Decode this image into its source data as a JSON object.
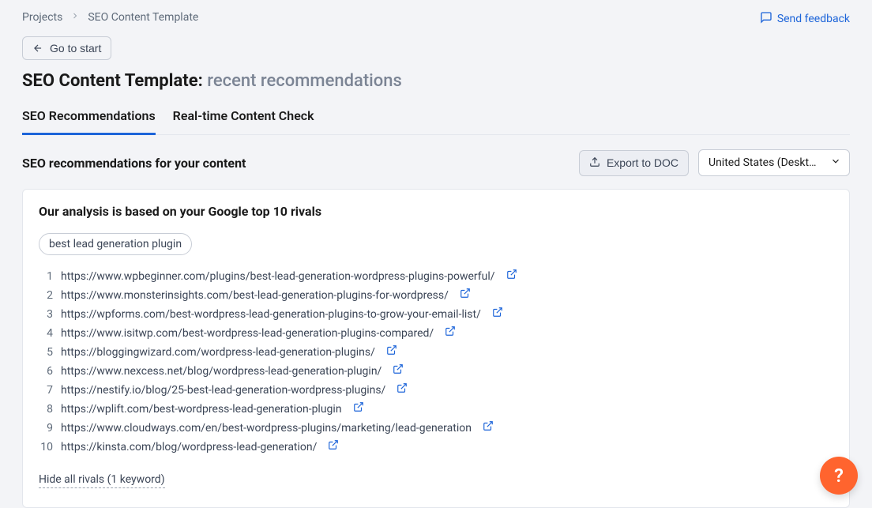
{
  "breadcrumb": {
    "root": "Projects",
    "current": "SEO Content Template"
  },
  "feedback_label": "Send feedback",
  "go_to_start_label": "Go to start",
  "title_prefix": "SEO Content Template:",
  "title_suffix": "recent recommendations",
  "tabs": {
    "seo_recommendations": "SEO Recommendations",
    "realtime_check": "Real-time Content Check"
  },
  "subheading": "SEO recommendations for your content",
  "export_button": "Export to DOC",
  "region_select": "United States (Deskt…",
  "card": {
    "heading": "Our analysis is based on your Google top 10 rivals",
    "keyword_pill": "best lead generation plugin",
    "rivals": [
      "https://www.wpbeginner.com/plugins/best-lead-generation-wordpress-plugins-powerful/",
      "https://www.monsterinsights.com/best-lead-generation-plugins-for-wordpress/",
      "https://wpforms.com/best-wordpress-lead-generation-plugins-to-grow-your-email-list/",
      "https://www.isitwp.com/best-wordpress-lead-generation-plugins-compared/",
      "https://bloggingwizard.com/wordpress-lead-generation-plugins/",
      "https://www.nexcess.net/blog/wordpress-lead-generation-plugin/",
      "https://nestify.io/blog/25-best-lead-generation-wordpress-plugins/",
      "https://wplift.com/best-wordpress-lead-generation-plugin",
      "https://www.cloudways.com/en/best-wordpress-plugins/marketing/lead-generation",
      "https://kinsta.com/blog/wordpress-lead-generation/"
    ],
    "hide_link": "Hide all rivals (1 keyword)"
  },
  "help_fab": "?"
}
